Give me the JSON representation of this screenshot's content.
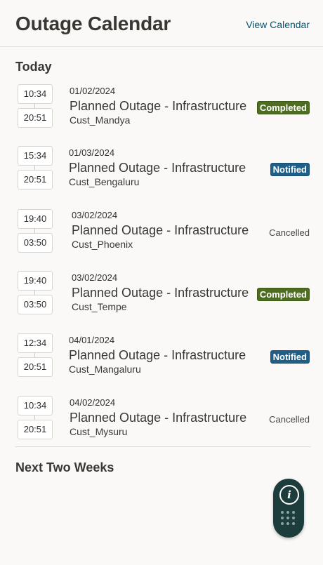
{
  "header": {
    "title": "Outage Calendar",
    "view_link": "View Calendar"
  },
  "sections": {
    "today": "Today",
    "next_two_weeks": "Next Two Weeks"
  },
  "outages": [
    {
      "start": "10:34",
      "end": "20:51",
      "date": "01/02/2024",
      "title": "Planned Outage - Infrastructure",
      "customer": "Cust_Mandya",
      "status": "Completed",
      "status_kind": "completed"
    },
    {
      "start": "15:34",
      "end": "20:51",
      "date": "01/03/2024",
      "title": "Planned Outage - Infrastructure",
      "customer": "Cust_Bengaluru",
      "status": "Notified",
      "status_kind": "notified"
    },
    {
      "start": "19:40",
      "end": "03:50",
      "date": "03/02/2024",
      "title": "Planned Outage - Infrastructure",
      "customer": "Cust_Phoenix",
      "status": "Cancelled",
      "status_kind": "cancelled"
    },
    {
      "start": "19:40",
      "end": "03:50",
      "date": "03/02/2024",
      "title": "Planned Outage - Infrastructure",
      "customer": "Cust_Tempe",
      "status": "Completed",
      "status_kind": "completed"
    },
    {
      "start": "12:34",
      "end": "20:51",
      "date": "04/01/2024",
      "title": "Planned Outage - Infrastructure",
      "customer": "Cust_Mangaluru",
      "status": "Notified",
      "status_kind": "notified"
    },
    {
      "start": "10:34",
      "end": "20:51",
      "date": "04/02/2024",
      "title": "Planned Outage - Infrastructure",
      "customer": "Cust_Mysuru",
      "status": "Cancelled",
      "status_kind": "cancelled"
    }
  ],
  "colors": {
    "accent_link": "#04536f",
    "completed": "#4e6d22",
    "notified": "#1f5f87",
    "fab": "#1d3c3c"
  },
  "icons": {
    "fab_top": "info-icon",
    "fab_bottom": "grid-icon"
  }
}
